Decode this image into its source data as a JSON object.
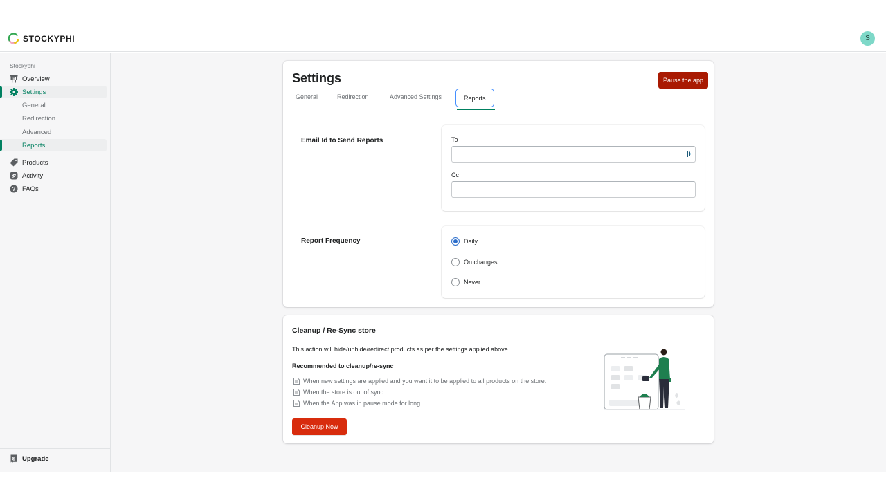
{
  "header": {
    "brand": "STOCKYPHI",
    "avatar_initial": "S",
    "brand_colors": {
      "green": "#34a853",
      "yellow": "#f4c20d",
      "pink": "#f8a5c2"
    }
  },
  "sidebar": {
    "store_name": "Stockyphi",
    "items": [
      {
        "label": "Overview",
        "icon": "presentation-icon",
        "active": false
      },
      {
        "label": "Settings",
        "icon": "gear-icon",
        "active": true
      },
      {
        "label": "General",
        "sub": true,
        "active": false
      },
      {
        "label": "Redirection",
        "sub": true,
        "active": false
      },
      {
        "label": "Advanced",
        "sub": true,
        "active": false
      },
      {
        "label": "Reports",
        "sub": true,
        "active": true
      },
      {
        "label": "Products",
        "icon": "tag-icon",
        "active": false
      },
      {
        "label": "Activity",
        "icon": "leaf-icon",
        "active": false
      },
      {
        "label": "FAQs",
        "icon": "question-icon",
        "active": false
      }
    ],
    "footer": {
      "label": "Upgrade",
      "icon": "receipt-dollar-icon"
    }
  },
  "settings": {
    "title": "Settings",
    "pause_button": "Pause the app",
    "tabs": [
      {
        "label": "General",
        "active": false
      },
      {
        "label": "Redirection",
        "active": false
      },
      {
        "label": "Advanced Settings",
        "active": false
      },
      {
        "label": "Reports",
        "active": true
      }
    ],
    "email_section": {
      "label": "Email Id to Send Reports",
      "to_label": "To",
      "to_value": "",
      "cc_label": "Cc",
      "cc_value": ""
    },
    "frequency_section": {
      "label": "Report Frequency",
      "options": [
        "Daily",
        "On changes",
        "Never"
      ],
      "selected": "Daily"
    }
  },
  "cleanup": {
    "title": "Cleanup / Re-Sync store",
    "description": "This action will hide/unhide/redirect products as per the settings applied above.",
    "subheading": "Recommended to cleanup/re-sync",
    "reasons": [
      "When new settings are applied and you want it to be applied to all products on the store.",
      "When the store is out of sync",
      "When the App was in pause mode for long"
    ],
    "button": "Cleanup Now"
  },
  "colors": {
    "accent_green": "#008060",
    "pause_red": "#a91a02",
    "cleanup_red": "#d82c0d",
    "radio_blue": "#2c6ecb",
    "tab_focus_blue": "#458fff"
  }
}
